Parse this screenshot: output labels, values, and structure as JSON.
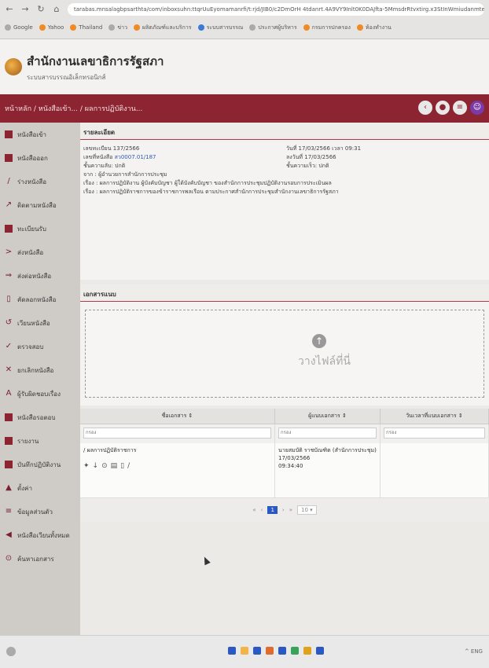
{
  "browser": {
    "address": "tarabas.mnsalagbpsarthta/com/inboxsuhn:ttqrUuEyomamanrfi/t:rjd/JIB0/c2DmOrH 4tdanrt.4A9VY9Inlt0K0DAJfta-5MmsdrRtvxtirg.x3StInWmiudanmtefloxuinvgqsiriayMhnsgAlDEM2tes"
  },
  "bookmarks": [
    "Google",
    "Yahoo",
    "Thailand",
    "ข่าว",
    "ผลิตภัณฑ์และบริการ",
    "ระบบสารบรรณ",
    "ประกาศผู้บริหาร",
    "กรมการปกครอง",
    "ห้องทำงาน"
  ],
  "header": {
    "title": "สำนักงานเลขาธิการรัฐสภา",
    "subtitle": "ระบบสารบรรณอิเล็กทรอนิกส์"
  },
  "breadcrumb": "หน้าหลัก / หนังสือเข้า... / ผลการปฏิบัติงาน...",
  "sidebar": {
    "items": [
      {
        "label": "หนังสือเข้า",
        "icon": "inbox-icon"
      },
      {
        "label": "หนังสือออก",
        "icon": "outbox-icon"
      },
      {
        "label": "ร่างหนังสือ",
        "icon": "edit-icon"
      },
      {
        "label": "ติดตามหนังสือ",
        "icon": "track-icon"
      },
      {
        "label": "ทะเบียนรับ",
        "icon": "register-icon"
      },
      {
        "label": "ส่งหนังสือ",
        "icon": "send-icon"
      },
      {
        "label": "ส่งต่อหนังสือ",
        "icon": "forward-icon"
      },
      {
        "label": "คัดลอกหนังสือ",
        "icon": "copy-icon"
      },
      {
        "label": "เวียนหนังสือ",
        "icon": "circulate-icon"
      },
      {
        "label": "ตรวจสอบ",
        "icon": "check-icon"
      },
      {
        "label": "ยกเลิกหนังสือ",
        "icon": "cancel-icon"
      },
      {
        "label": "ผู้รับผิดชอบเรื่อง",
        "icon": "person-icon"
      },
      {
        "label": "หนังสือรอตอบ",
        "icon": "pending-icon"
      },
      {
        "label": "รายงาน",
        "icon": "report-icon"
      },
      {
        "label": "บันทึกปฏิบัติงาน",
        "icon": "log-icon"
      },
      {
        "label": "ตั้งค่า",
        "icon": "settings-icon"
      },
      {
        "label": "ข้อมูลส่วนตัว",
        "icon": "profile-icon"
      },
      {
        "label": "หนังสือเวียนทั้งหมด",
        "icon": "all-docs-icon"
      },
      {
        "label": "ค้นหาเอกสาร",
        "icon": "search-icon"
      }
    ]
  },
  "details": {
    "head": "รายละเอียด",
    "doc_no": "เลขทะเบียน 137/2566",
    "doc_ref_label": "เลขที่หนังสือ",
    "doc_ref": "สว0007.01/187",
    "secrecy": "ชั้นความลับ: ปกติ",
    "from": "จาก : ผู้อำนวยการสำนักการประชุม",
    "subject_1": "เรื่อง : ผลการปฏิบัติงาน ผู้บังคับบัญชา ผู้ใต้บังคับบัญชา ของสำนักการประชุมปฏิบัติงานรอบการประเมินผล",
    "subject_2": "เรื่อง : ผลการปฏิบัติราชการของข้าราชการพลเรือน ตามประกาศสำนักการประชุมสำนักงานเลขาธิการรัฐสภา",
    "date_recv": "วันที่ 17/03/2566 เวลา 09:31",
    "date_doc": "ลงวันที่ 17/03/2566",
    "urgency": "ชั้นความเร็ว: ปกติ"
  },
  "attachments": {
    "head": "เอกสารแนบ",
    "drop_text": "วางไฟล์ที่นี่"
  },
  "table": {
    "headers": [
      "ชื่อเอกสาร ⇕",
      "ผู้แนบเอกสาร ⇕",
      "วันเวลาที่แนบเอกสาร ⇕"
    ],
    "filter_placeholders": [
      "กรอง",
      "กรอง",
      "กรอง"
    ],
    "row": {
      "title": "ผลการปฏิบัติราชการ",
      "attached_by": "นายสมบัติ ราชบัณฑิต (สำนักการประชุม) 17/03/2566",
      "time": "09:34:40"
    }
  },
  "pagination": {
    "current": "1",
    "page_size": "10 ▾"
  },
  "taskbar": {
    "right_text": "^ ENG",
    "colors": [
      "#2b59c3",
      "#f2b34a",
      "#2b59c3",
      "#e06b2e",
      "#2b59c3",
      "#3aa35a",
      "#e0a21a",
      "#2b59c3"
    ]
  }
}
